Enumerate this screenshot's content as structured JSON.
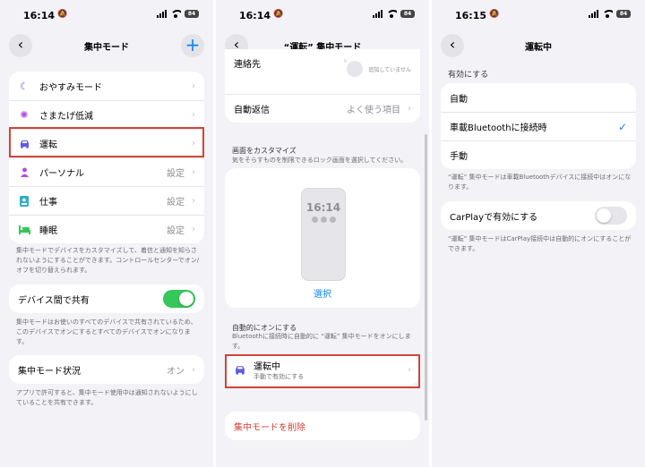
{
  "colors": {
    "accent": "#0a84ff",
    "toggle_on": "#34c759",
    "highlight": "#d0443a",
    "destructive": "#d0443a"
  },
  "screen1": {
    "status": {
      "time": "16:14",
      "battery": "84"
    },
    "title": "集中モード",
    "modes": [
      {
        "icon": "moon-icon",
        "label": "おやすみモード",
        "value": ""
      },
      {
        "icon": "mindfulness-icon",
        "label": "さまたげ低減",
        "value": ""
      },
      {
        "icon": "car-icon",
        "label": "運転",
        "value": ""
      },
      {
        "icon": "person-icon",
        "label": "パーソナル",
        "value": "設定"
      },
      {
        "icon": "work-badge-icon",
        "label": "仕事",
        "value": "設定"
      },
      {
        "icon": "bed-icon",
        "label": "睡眠",
        "value": "設定"
      }
    ],
    "modes_footer": "集中モードでデバイスをカスタマイズして、着信と通知を知らされないようにすることができます。コントロールセンターでオン/オフを切り替えられます。",
    "share_label": "デバイス間で共有",
    "share_on": true,
    "share_footer": "集中モードはお使いのすべてのデバイスで共有されているため、このデバイスでオンにするとすべてのデバイスでオンになります。",
    "status_label": "集中モード状況",
    "status_value": "オン",
    "status_footer": "アプリで許可すると、集中モード使用中は通知されないようにしていることを共有できます。"
  },
  "screen2": {
    "status": {
      "time": "16:14",
      "battery": "84"
    },
    "title": "“運転” 集中モード",
    "contacts_label": "連絡先",
    "contacts_value": "追加していません",
    "autoreply_label": "自動返信",
    "autoreply_value": "よく使う項目",
    "lock_header": "画面をカスタマイズ",
    "lock_desc": "気をそらすものを制限できるロック画面を選択してください。",
    "lock_time": "16:14",
    "lock_select": "選択",
    "auto_header": "自動的にオンにする",
    "auto_desc": "Bluetoothに接続時に自動的に “運転” 集中モードをオンにします。",
    "driving_label": "運転中",
    "driving_sub": "手動で有効にする",
    "delete_label": "集中モードを削除"
  },
  "screen3": {
    "status": {
      "time": "16:15",
      "battery": "84"
    },
    "title": "運転中",
    "section_header": "有効にする",
    "options": [
      {
        "label": "自動",
        "checked": false
      },
      {
        "label": "車載Bluetoothに接続時",
        "checked": true
      },
      {
        "label": "手動",
        "checked": false
      }
    ],
    "options_footer": "“運転” 集中モードは車載Bluetoothデバイスに接続中はオンになります。",
    "carplay_label": "CarPlayで有効にする",
    "carplay_on": false,
    "carplay_footer": "“運転” 集中モードはCarPlay接続中は自動的にオンにすることができます。"
  }
}
